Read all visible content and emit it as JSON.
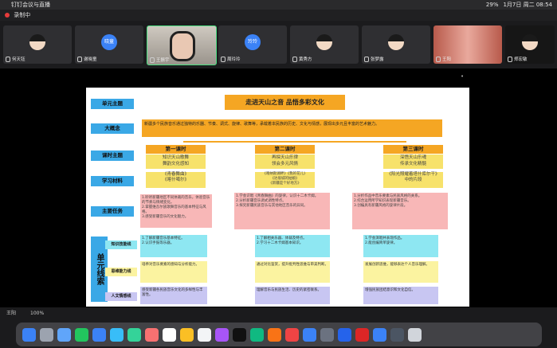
{
  "menubar": {
    "app": "钉钉会议与直播",
    "time": "1月7日 周二 08:54",
    "battery": "29%"
  },
  "recording": {
    "label": "录制中"
  },
  "participants": [
    {
      "name": "何天钰"
    },
    {
      "name": "谢晓童",
      "avatar_text": "晓童"
    },
    {
      "name": "王振宇"
    },
    {
      "name": "周玲玲",
      "avatar_text": "玲玲"
    },
    {
      "name": "黄秀方"
    },
    {
      "name": "张梦露"
    },
    {
      "name": "王阳"
    },
    {
      "name": "郑宏敏"
    }
  ],
  "slide": {
    "title": "走进天山之音 品悟多彩文化",
    "labels": {
      "unit_theme": "单元主题",
      "concept": "大概念",
      "lesson_theme": "课时主题",
      "materials": "学习材料",
      "tasks": "主要任务",
      "unit_line": "单元线索"
    },
    "concept_text": "新疆多个民族音乐通过独特的乐器、节奏、调式、旋律、歌舞等，承载着本民族的历史、文化与情感，展现出多元且丰富的艺术魅力。",
    "lessons": [
      {
        "name": "第一课时",
        "topic": "知识天山歌舞\n舞韵文化感知",
        "material": "《青春舞曲》\n《喀什噶尔》",
        "task": "1.聆听新疆地区不同体裁的音乐，体验音乐的节奏与情绪变化。\n2.掌握维吾尔族歌舞音乐的基本特征与风格。\n3.感受新疆音乐的文化魅力。"
      },
      {
        "name": "第二课时",
        "topic": "再探天山乐律\n领会多元风情",
        "material": "《喀纳斯湖畔》《我的花儿》\n《达坂城的姑娘》\n《新疆是个好地方》",
        "task": "1.学会识唱《青春舞曲》的旋律，认识十二木卡姆。\n2.分析新疆音乐调式调性特点。\n3.探究新疆民族音乐与其他地区音乐的异同。"
      },
      {
        "name": "第三课时",
        "topic": "深悟天山乐魂\n传承文化精髓",
        "material": "《阳光照耀着塔什库尔干》\n中的片段",
        "task": "1.分析作品中音乐要素与民族风格的关系。\n2.综合运用所学知识表现新疆音乐。\n3.创编具有新疆风格的旋律片段。"
      }
    ],
    "threads": [
      {
        "label": "知识技能线",
        "cells": [
          "1.了解新疆音乐基本特征。\n2.认识手鼓等乐器。",
          "1.了解相关乐器、体裁及特点。\n2.学习十二木卡姆基本知识。",
          "1.学会演唱并表现作品。\n2.能创编简单旋律。"
        ]
      },
      {
        "label": "思维能力线",
        "cells": [
          "培养对音乐要素的感知与分析能力。",
          "通过对比鉴赏，提升批判性思维与审美判断。",
          "发展创新思维，能够表达个人音乐理解。"
        ]
      },
      {
        "label": "人文情感线",
        "cells": [
          "感受新疆各民族音乐文化的多样性与丰富性。",
          "理解音乐与民族生活、历史的紧密联系。",
          "增强民族团结意识和文化自信。"
        ]
      }
    ]
  },
  "status": {
    "me": "王阳",
    "zoom": "100%"
  }
}
